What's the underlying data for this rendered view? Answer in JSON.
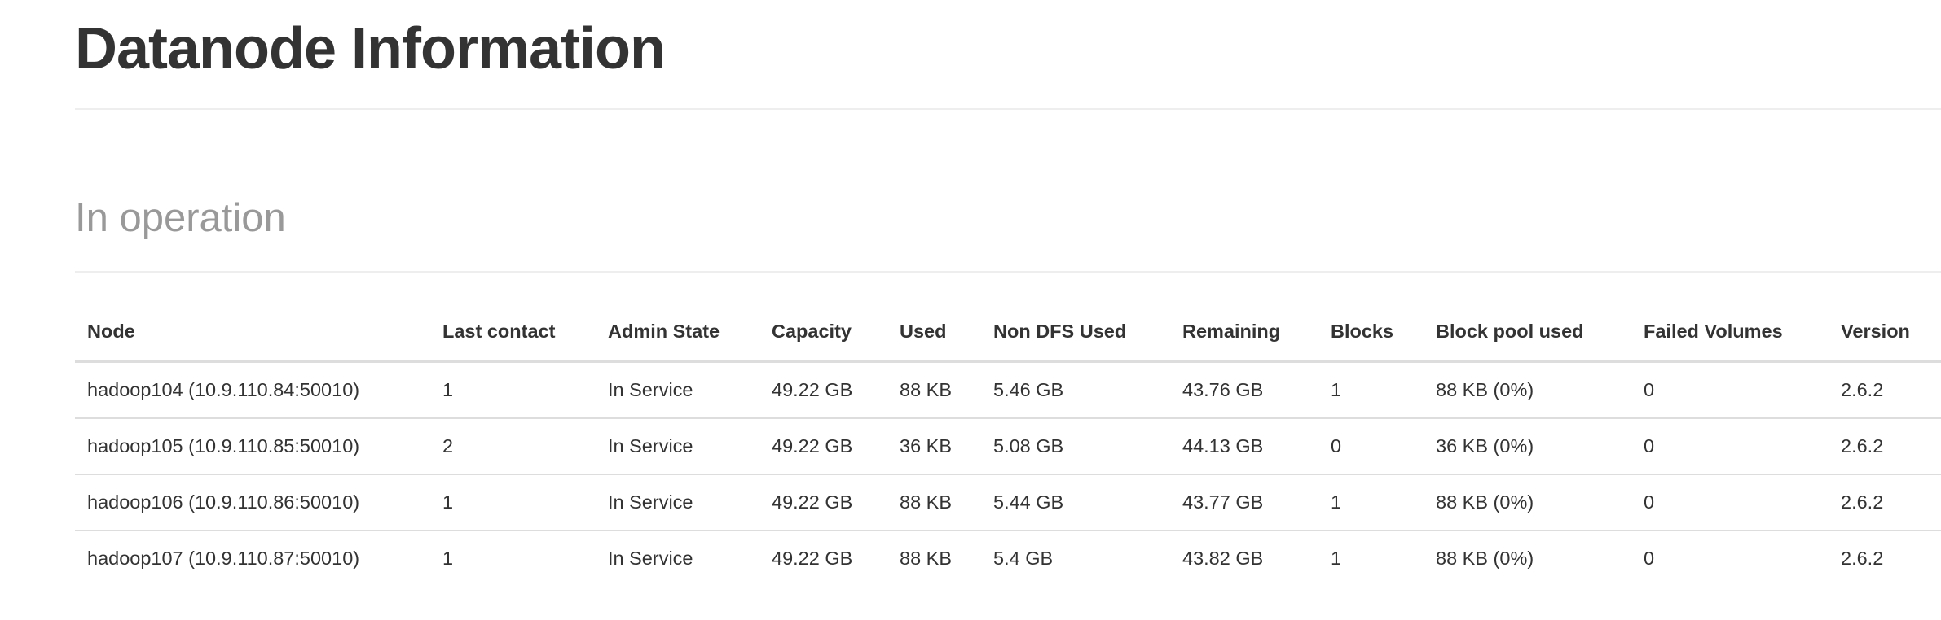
{
  "header": {
    "title": "Datanode Information"
  },
  "section": {
    "title": "In operation"
  },
  "table": {
    "columns": [
      "Node",
      "Last contact",
      "Admin State",
      "Capacity",
      "Used",
      "Non DFS Used",
      "Remaining",
      "Blocks",
      "Block pool used",
      "Failed Volumes",
      "Version"
    ],
    "rows": [
      [
        "hadoop104 (10.9.110.84:50010)",
        "1",
        "In Service",
        "49.22 GB",
        "88 KB",
        "5.46 GB",
        "43.76 GB",
        "1",
        "88 KB (0%)",
        "0",
        "2.6.2"
      ],
      [
        "hadoop105 (10.9.110.85:50010)",
        "2",
        "In Service",
        "49.22 GB",
        "36 KB",
        "5.08 GB",
        "44.13 GB",
        "0",
        "36 KB (0%)",
        "0",
        "2.6.2"
      ],
      [
        "hadoop106 (10.9.110.86:50010)",
        "1",
        "In Service",
        "49.22 GB",
        "88 KB",
        "5.44 GB",
        "43.77 GB",
        "1",
        "88 KB (0%)",
        "0",
        "2.6.2"
      ],
      [
        "hadoop107 (10.9.110.87:50010)",
        "1",
        "In Service",
        "49.22 GB",
        "88 KB",
        "5.4 GB",
        "43.82 GB",
        "1",
        "88 KB (0%)",
        "0",
        "2.6.2"
      ]
    ]
  }
}
